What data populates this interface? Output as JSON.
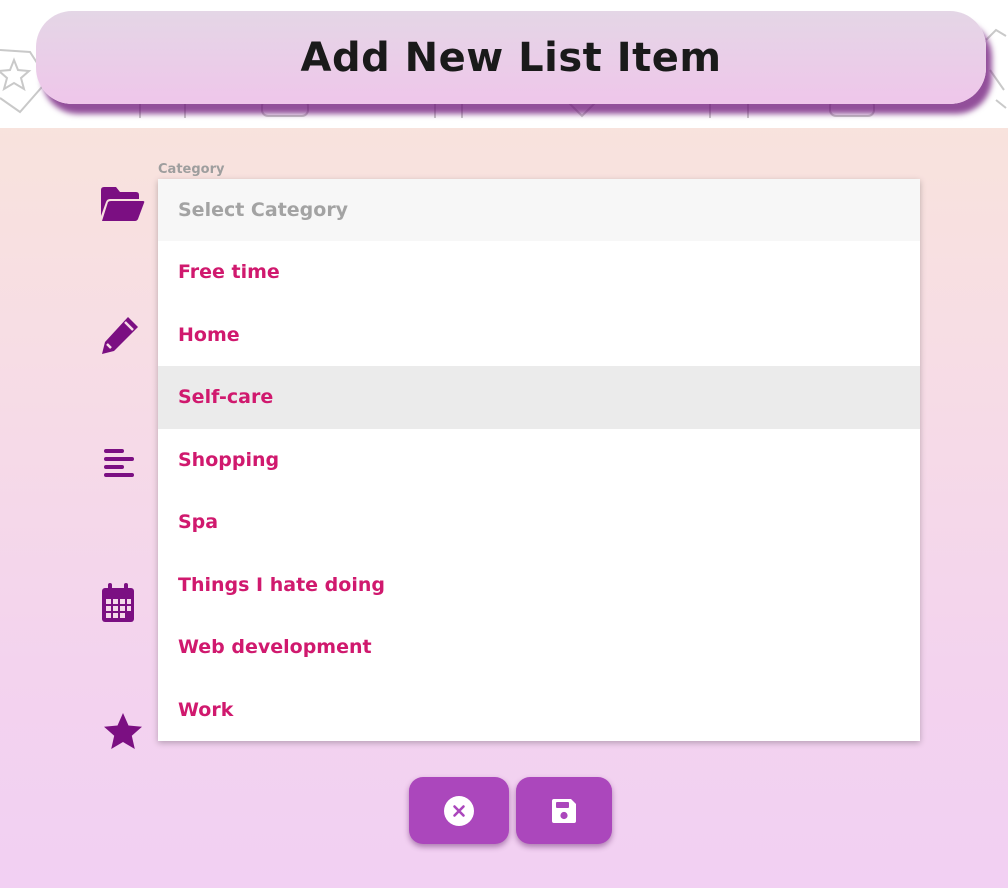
{
  "header": {
    "title": "Add New List Item"
  },
  "category_field": {
    "label": "Category",
    "placeholder": "Select Category",
    "options": [
      "Free time",
      "Home",
      "Self-care",
      "Shopping",
      "Spa",
      "Things I hate doing",
      "Web development",
      "Work"
    ],
    "highlighted_option": "Self-care"
  },
  "side_icons": [
    "folder-open-icon",
    "pencil-icon",
    "align-left-icon",
    "calendar-icon",
    "star-icon"
  ],
  "buttons": {
    "cancel_icon": "close-circle-icon",
    "save_icon": "floppy-disk-icon"
  },
  "colors": {
    "accent": "#ab47bc",
    "icon": "#7b0f82",
    "option_text": "#d0196e",
    "header_shadow": "#6e1478"
  }
}
